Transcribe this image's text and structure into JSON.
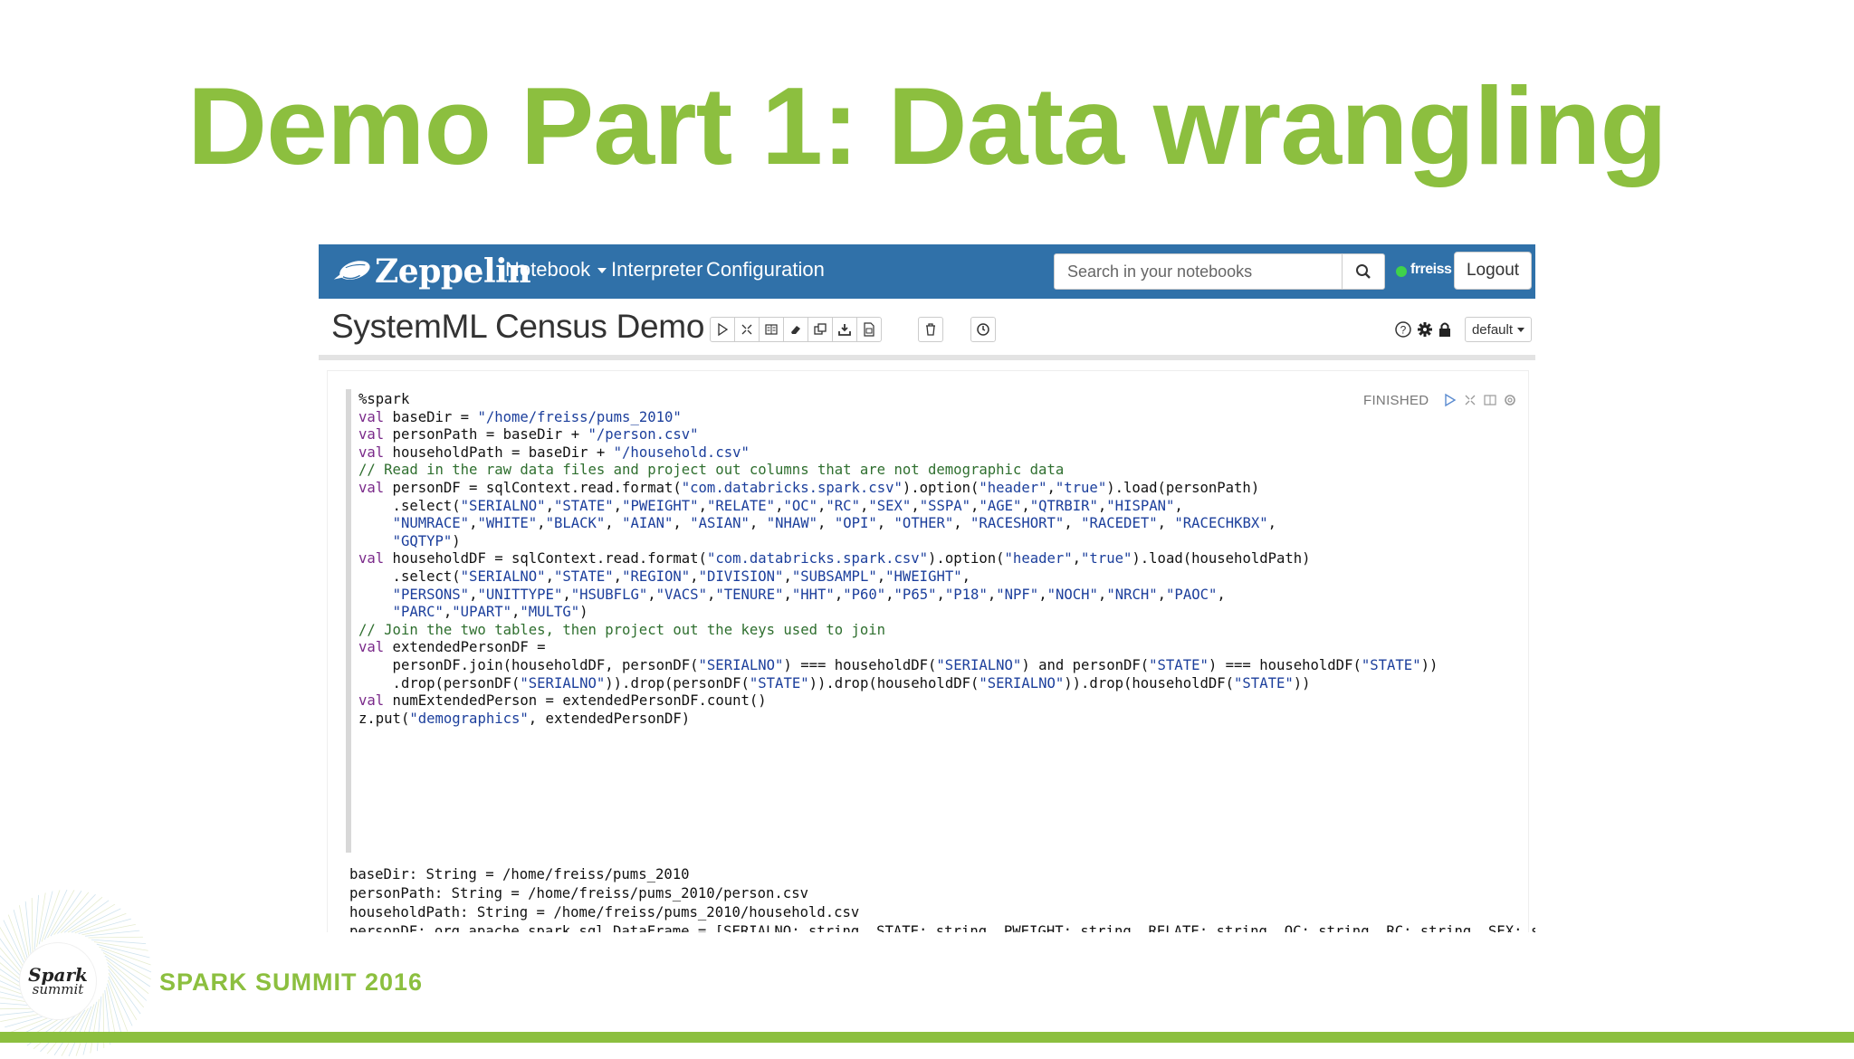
{
  "slide": {
    "title": "Demo Part 1: Data wrangling",
    "footer_text": "SPARK SUMMIT 2016",
    "footer_logo_line1": "Spark",
    "footer_logo_line2": "summit"
  },
  "navbar": {
    "logo_text": "Zeppelin",
    "items": [
      {
        "label": "Notebook",
        "has_dropdown": true
      },
      {
        "label": "Interpreter"
      },
      {
        "label": "Configuration"
      }
    ],
    "search_placeholder": "Search in your notebooks",
    "user": "frreiss",
    "logout_label": "Logout"
  },
  "notebook": {
    "title": "SystemML Census Demo",
    "toolbar_icons": [
      "run-all-icon",
      "hide-code-icon",
      "hide-output-icon",
      "clear-output-icon",
      "clone-icon",
      "export-icon",
      "version-icon",
      "delete-icon",
      "schedule-icon"
    ],
    "right_icons": [
      "help-icon",
      "settings-icon",
      "lock-icon"
    ],
    "view_mode": "default"
  },
  "paragraph": {
    "status": "FINISHED",
    "code_lines": [
      "%spark",
      "",
      "val baseDir = \"/home/freiss/pums_2010\"",
      "val personPath = baseDir + \"/person.csv\"",
      "val householdPath = baseDir + \"/household.csv\"",
      "",
      "// Read in the raw data files and project out columns that are not demographic data",
      "val personDF = sqlContext.read.format(\"com.databricks.spark.csv\").option(\"header\",\"true\").load(personPath)",
      "    .select(\"SERIALNO\",\"STATE\",\"PWEIGHT\",\"RELATE\",\"OC\",\"RC\",\"SEX\",\"SSPA\",\"AGE\",\"QTRBIR\",\"HISPAN\",",
      "    \"NUMRACE\",\"WHITE\",\"BLACK\", \"AIAN\", \"ASIAN\", \"NHAW\", \"OPI\", \"OTHER\", \"RACESHORT\", \"RACEDET\", \"RACECHKBX\",",
      "    \"GQTYP\")",
      "",
      "val householdDF = sqlContext.read.format(\"com.databricks.spark.csv\").option(\"header\",\"true\").load(householdPath)",
      "    .select(\"SERIALNO\",\"STATE\",\"REGION\",\"DIVISION\",\"SUBSAMPL\",\"HWEIGHT\",",
      "    \"PERSONS\",\"UNITTYPE\",\"HSUBFLG\",\"VACS\",\"TENURE\",\"HHT\",\"P60\",\"P65\",\"P18\",\"NPF\",\"NOCH\",\"NRCH\",\"PAOC\",",
      "    \"PARC\",\"UPART\",\"MULTG\")",
      "",
      "// Join the two tables, then project out the keys used to join",
      "val extendedPersonDF =",
      "    personDF.join(householdDF, personDF(\"SERIALNO\") === householdDF(\"SERIALNO\") and personDF(\"STATE\") === householdDF(\"STATE\"))",
      "    .drop(personDF(\"SERIALNO\")).drop(personDF(\"STATE\")).drop(householdDF(\"SERIALNO\")).drop(householdDF(\"STATE\"))",
      "",
      "val numExtendedPerson = extendedPersonDF.count()",
      "",
      "z.put(\"demographics\", extendedPersonDF)"
    ],
    "output_lines": [
      "baseDir: String = /home/freiss/pums_2010",
      "personPath: String = /home/freiss/pums_2010/person.csv",
      "householdPath: String = /home/freiss/pums_2010/household.csv",
      "personDF: org.apache.spark.sql.DataFrame = [SERIALNO: string, STATE: string, PWEIGHT: string, RELATE: string, OC: string, RC: string, SEX: strin"
    ]
  },
  "colors": {
    "title_green": "#8cbf3f",
    "navbar_blue": "#3071a9",
    "status_green": "#3fd24a"
  }
}
